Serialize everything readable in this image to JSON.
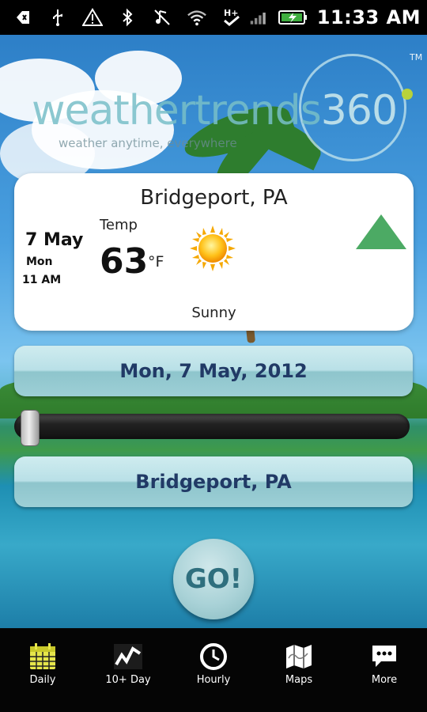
{
  "status_bar": {
    "time": "11:33 AM",
    "icons": [
      "back-arrow-icon",
      "usb-icon",
      "warning-icon",
      "bluetooth-icon",
      "mute-icon",
      "wifi-icon",
      "hplus-network-icon",
      "signal-icon",
      "battery-charging-icon"
    ]
  },
  "logo": {
    "main_text": "weathertrends",
    "number_text": "360",
    "tagline": "weather anytime, everywhere",
    "tm": "TM"
  },
  "card": {
    "city": "Bridgeport, PA",
    "date_big": "7 May",
    "day": "Mon",
    "time": "11 AM",
    "temp_label": "Temp",
    "temp_value": "63",
    "temp_unit": "°F",
    "condition": "Sunny",
    "condition_icon": "sun-icon",
    "trend_icon": "trend-up-icon"
  },
  "date_button": {
    "label": "Mon, 7 May, 2012"
  },
  "slider": {
    "value": 0.0
  },
  "location_button": {
    "label": "Bridgeport, PA"
  },
  "go_button": {
    "label": "GO!"
  },
  "nav": {
    "items": [
      {
        "label": "Daily",
        "icon": "calendar-icon",
        "active": true
      },
      {
        "label": "10+ Day",
        "icon": "trend-chart-icon",
        "active": false
      },
      {
        "label": "Hourly",
        "icon": "clock-icon",
        "active": false
      },
      {
        "label": "Maps",
        "icon": "map-icon",
        "active": false
      },
      {
        "label": "More",
        "icon": "speech-bubble-icon",
        "active": false
      }
    ]
  },
  "colors": {
    "accent_yellow": "#e6e64a",
    "trend_green": "#4caa64",
    "pill_text": "#213a66"
  }
}
